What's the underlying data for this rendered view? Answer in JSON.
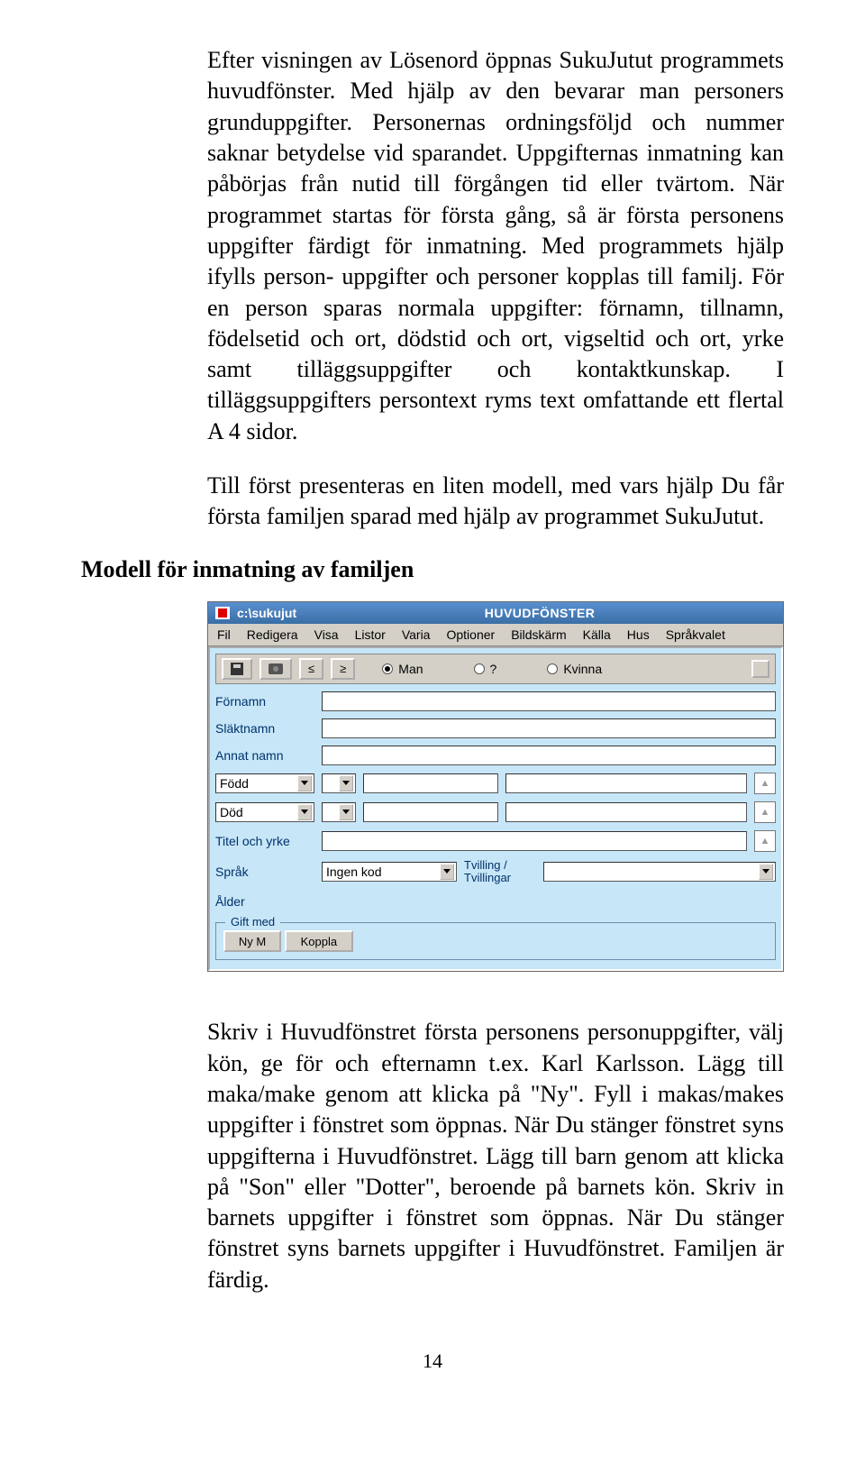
{
  "para1": "Efter visningen av Lösenord öppnas SukuJutut programmets huvudfönster. Med hjälp av den bevarar man personers grunduppgifter. Personernas ordningsföljd och nummer saknar betydelse vid sparandet. Uppgifternas inmatning kan påbörjas från nutid till förgången tid eller tvärtom. När programmet startas för första gång, så är första personens uppgifter färdigt för inmatning. Med programmets hjälp ifylls person- uppgifter och personer kopplas till familj. För en person sparas normala uppgifter: förnamn, tillnamn, födelsetid och ort, dödstid och ort, vigseltid och ort, yrke samt tilläggsuppgifter och kontaktkunskap. I tilläggsuppgifters persontext ryms text omfattande ett flertal A 4 sidor.",
  "para2": "Till först presenteras en liten modell, med vars hjälp Du får första familjen sparad med hjälp av programmet SukuJutut.",
  "heading": "Modell för inmatning av familjen",
  "para3": "Skriv i Huvudfönstret första personens personuppgifter, välj kön, ge för och efternamn t.ex. Karl Karlsson. Lägg till maka/make genom att klicka på \"Ny\". Fyll i makas/makes uppgifter i fönstret som öppnas. När Du stänger fönstret syns uppgifterna i Huvudfönstret. Lägg till barn genom att klicka på \"Son\" eller \"Dotter\", beroende på barnets kön. Skriv in barnets uppgifter i fönstret som öppnas. När Du stänger fönstret syns barnets uppgifter i Huvudfönstret. Familjen är färdig.",
  "page_number": "14",
  "shot": {
    "title_path": "c:\\sukujut",
    "title_main": "HUVUDFÖNSTER",
    "menu": [
      "Fil",
      "Redigera",
      "Visa",
      "Listor",
      "Varia",
      "Optioner",
      "Bildskärm",
      "Källa",
      "Hus",
      "Språkvalet"
    ],
    "nav_prev": "≤",
    "nav_next": "≥",
    "gender_man": "Man",
    "gender_unknown": "?",
    "gender_kvinna": "Kvinna",
    "labels": {
      "fornamn": "Förnamn",
      "slaktnamn": "Släktnamn",
      "annat": "Annat namn",
      "fodd": "Född",
      "dod": "Död",
      "titel": "Titel och yrke",
      "sprak": "Språk",
      "sprak_value": "Ingen kod",
      "tvilling": "Tvilling / Tvillingar",
      "alder": "Ålder",
      "gift": "Gift med",
      "ny_m": "Ny M",
      "koppla": "Koppla"
    }
  }
}
